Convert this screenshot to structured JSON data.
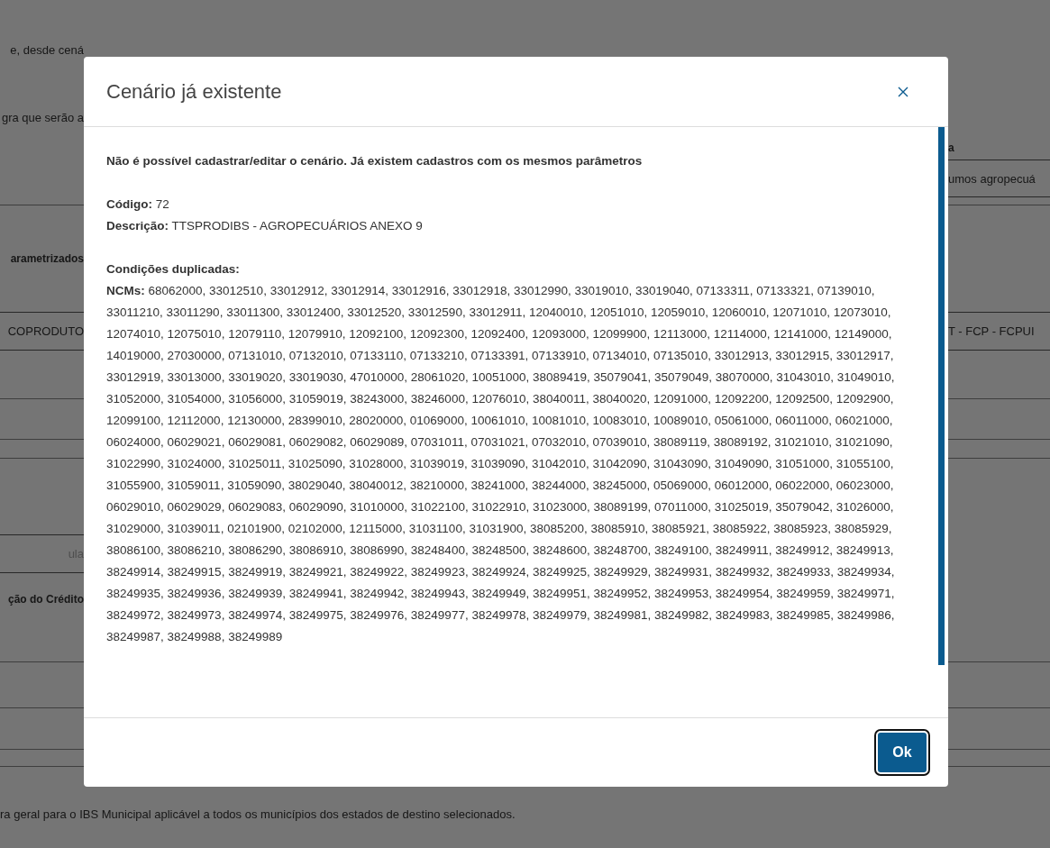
{
  "background": {
    "intro_text": "e, desde cená",
    "rule_text": "gra que serão a",
    "column_header": "a",
    "field_value": "umos agropecuá",
    "section_label": "arametrizados",
    "row_left": "COPRODUTO",
    "row_right": "T - FCP - FCPUI",
    "input_placeholder": "ula",
    "section_title": "ção do Crédito",
    "footer_note": "ra geral para o IBS Municipal aplicável a todos os municípios dos estados de destino selecionados."
  },
  "dialog": {
    "title": "Cenário já existente",
    "message": "Não é possível cadastrar/editar o cenário. Já existem cadastros com os mesmos parâmetros",
    "code": "**Código:** 72",
    "description": "**Descrição:** TTSPRODIBS - AGROPECUÁRIOS ANEXO 9",
    "duplicates_title": "Condições duplicadas:",
    "ncms": "**NCMs:** 68062000, 33012510, 33012912, 33012914, 33012916, 33012918, 33012990, 33019010, 33019040, 07133311, 07133321, 07139010, 33011210, 33011290, 33011300, 33012400, 33012520, 33012590, 33012911, 12040010, 12051010, 12059010, 12060010, 12071010, 12073010, 12074010, 12075010, 12079110, 12079910, 12092100, 12092300, 12092400, 12093000, 12099900, 12113000, 12114000, 12141000, 12149000, 14019000, 27030000, 07131010, 07132010, 07133110, 07133210, 07133391, 07133910, 07134010, 07135010, 33012913, 33012915, 33012917, 33012919, 33013000, 33019020, 33019030, 47010000, 28061020, 10051000, 38089419, 35079041, 35079049, 38070000, 31043010, 31049010, 31052000, 31054000, 31056000, 31059019, 38243000, 38246000, 12076010, 38040011, 38040020, 12091000, 12092200, 12092500, 12092900, 12099100, 12112000, 12130000, 28399010, 28020000, 01069000, 10061010, 10081010, 10083010, 10089010, 05061000, 06011000, 06021000, 06024000, 06029021, 06029081, 06029082, 06029089, 07031011, 07031021, 07032010, 07039010, 38089119, 38089192, 31021010, 31021090, 31022990, 31024000, 31025011, 31025090, 31028000, 31039019, 31039090, 31042010, 31042090, 31043090, 31049090, 31051000, 31055100, 31055900, 31059011, 31059090, 38029040, 38040012, 38210000, 38241000, 38244000, 38245000, 05069000, 06012000, 06022000, 06023000, 06029010, 06029029, 06029083, 06029090, 31010000, 31022100, 31022910, 31023000, 38089199, 07011000, 31025019, 35079042, 31026000, 31029000, 31039011, 02101900, 02102000, 12115000, 31031100, 31031900, 38085200, 38085910, 38085921, 38085922, 38085923, 38085929, 38086100, 38086210, 38086290, 38086910, 38086990, 38248400, 38248500, 38248600, 38248700, 38249100, 38249911, 38249912, 38249913, 38249914, 38249915, 38249919, 38249921, 38249922, 38249923, 38249924, 38249925, 38249929, 38249931, 38249932, 38249933, 38249934, 38249935, 38249936, 38249939, 38249941, 38249942, 38249943, 38249949, 38249951, 38249952, 38249953, 38249954, 38249959, 38249971, 38249972, 38249973, 38249974, 38249975, 38249976, 38249977, 38249978, 38249979, 38249981, 38249982, 38249983, 38249985, 38249986, 38249987, 38249988, 38249989",
    "ok_button": "Ok"
  }
}
